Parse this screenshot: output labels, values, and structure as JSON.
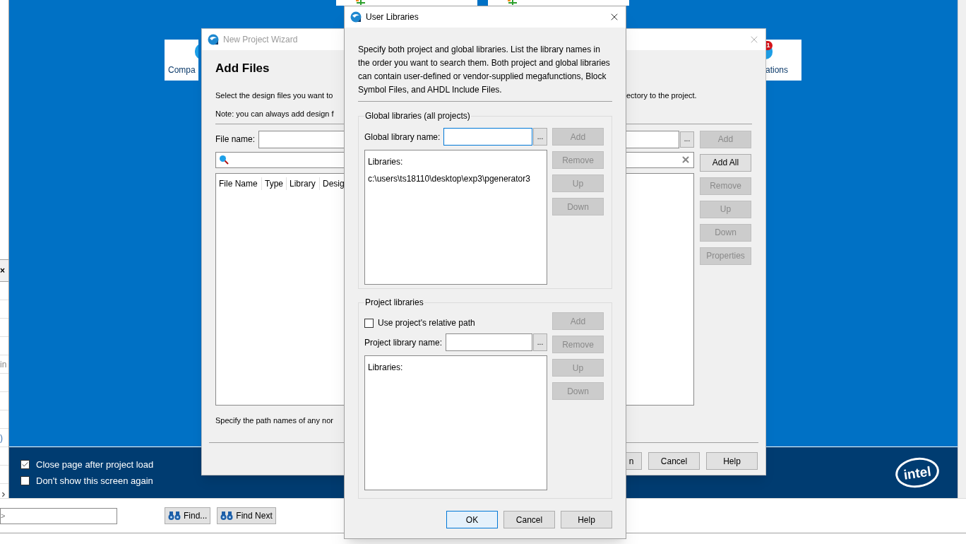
{
  "background_app": {
    "toolbar_items": [
      {
        "kind": "network"
      },
      {
        "kind": "network"
      }
    ],
    "start_tiles": [
      {
        "label": "Compa"
      },
      {
        "label": "ations",
        "badge": "1"
      }
    ],
    "side_panel": {
      "close": "×",
      "fragments": [
        "in",
        ")"
      ]
    },
    "footer_options": [
      {
        "label": "Close page after project load",
        "checked": true
      },
      {
        "label": "Don't show this screen again",
        "checked": false
      }
    ],
    "logo": "intel",
    "find_bar": {
      "value": ">",
      "buttons": [
        "Find...",
        "Find Next"
      ]
    }
  },
  "wizard": {
    "title": "New Project Wizard",
    "active": false,
    "heading": "Add Files",
    "description_left": [
      "Select the design files you want to",
      "Note: you can always add design f"
    ],
    "description_right": "ectory to the project.",
    "file_name_label": "File name:",
    "browse": "...",
    "table_columns": [
      "File Name",
      "Type",
      "Library",
      "Desig"
    ],
    "side_buttons": [
      {
        "label": "Add",
        "disabled": true
      },
      {
        "label": "Add All",
        "disabled": false
      },
      {
        "label": "Remove",
        "disabled": true
      },
      {
        "label": "Up",
        "disabled": true
      },
      {
        "label": "Down",
        "disabled": true
      },
      {
        "label": "Properties",
        "disabled": true
      }
    ],
    "footer_text": "Specify the path names of any nor",
    "buttons": [
      {
        "label": "n"
      },
      {
        "label": "Cancel"
      },
      {
        "label": "Help"
      }
    ]
  },
  "user_libraries": {
    "title": "User Libraries",
    "active": true,
    "description": "Specify both project and global libraries. List the library names in the order you want to search them. Both project and global libraries can contain user-defined or vendor-supplied megafunctions, Block Symbol Files, and AHDL Include Files.",
    "global": {
      "legend": "Global libraries (all projects)",
      "name_label": "Global library name:",
      "browse": "...",
      "list_label": "Libraries:",
      "libraries": [
        "c:\\users\\ts18110\\desktop\\exp3\\pgenerator3"
      ],
      "buttons": [
        {
          "label": "Add",
          "disabled": true
        },
        {
          "label": "Remove",
          "disabled": true
        },
        {
          "label": "Up",
          "disabled": true
        },
        {
          "label": "Down",
          "disabled": true
        }
      ]
    },
    "project": {
      "legend": "Project libraries",
      "relative_path": {
        "label": "Use project's relative path",
        "checked": false
      },
      "name_label": "Project library name:",
      "browse": "...",
      "list_label": "Libraries:",
      "buttons": [
        {
          "label": "Add",
          "disabled": true
        },
        {
          "label": "Remove",
          "disabled": true
        },
        {
          "label": "Up",
          "disabled": true
        },
        {
          "label": "Down",
          "disabled": true
        }
      ]
    },
    "buttons": [
      {
        "label": "OK",
        "default": true
      },
      {
        "label": "Cancel",
        "default": false
      },
      {
        "label": "Help",
        "default": false
      }
    ]
  }
}
